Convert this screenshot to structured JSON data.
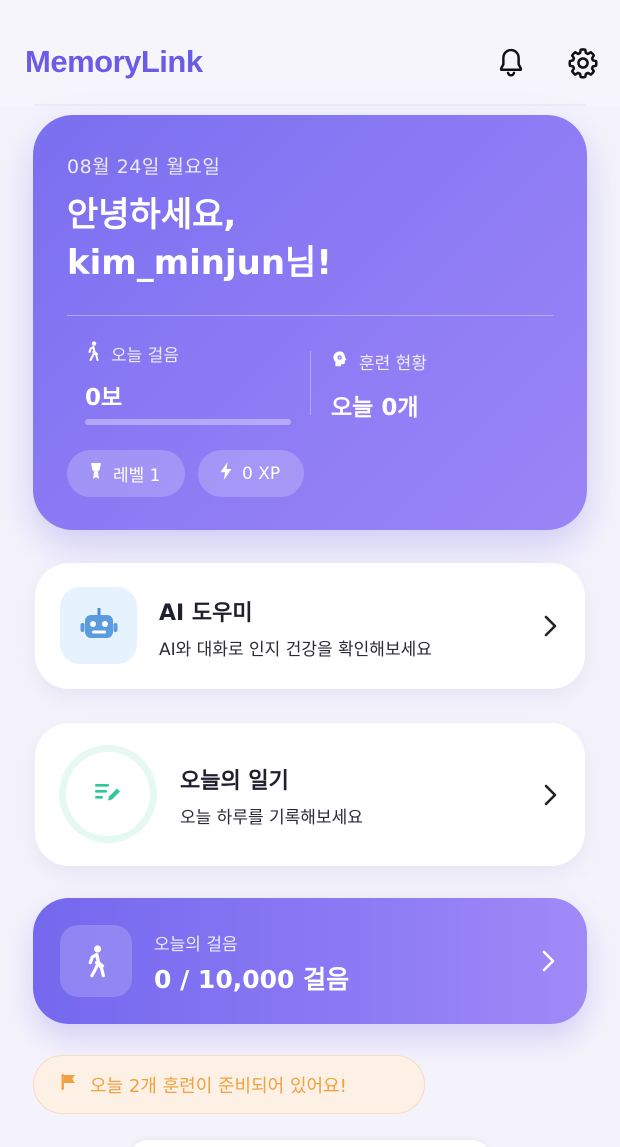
{
  "header": {
    "brand": "MemoryLink",
    "bell_icon": "bell-icon",
    "settings_icon": "gear-icon"
  },
  "hero": {
    "date": "08월 24일 월요일",
    "greeting_line1": "안녕하세요,",
    "greeting_line2": "kim_minjun님!",
    "steps": {
      "label": "오늘 걸음",
      "value": "0보",
      "progress_percent": 0
    },
    "training": {
      "label": "훈련 현황",
      "value": "오늘 0개"
    },
    "chips": {
      "level": "레벨 1",
      "xp": "0 XP"
    }
  },
  "ai_card": {
    "title": "AI 도우미",
    "subtitle": "AI와 대화로 인지 건강을 확인해보세요",
    "icon": "robot-icon",
    "icon_bg": "#e6f2fd"
  },
  "diary_card": {
    "title": "오늘의 일기",
    "subtitle": "오늘 하루를 기록해보세요",
    "icon": "edit-notes-icon",
    "icon_color": "#2fc79a"
  },
  "steps_card": {
    "label": "오늘의 걸음",
    "value": "0 / 10,000 걸음",
    "icon": "walking-icon"
  },
  "notice": {
    "text": "오늘 2개 훈련이 준비되어 있어요!",
    "icon": "flag-icon",
    "color": "#f0a242"
  },
  "colors": {
    "brand": "#6b5ce7",
    "hero_start": "#7a6ff0",
    "hero_end": "#9a85f6",
    "background": "#f4f3fb"
  }
}
